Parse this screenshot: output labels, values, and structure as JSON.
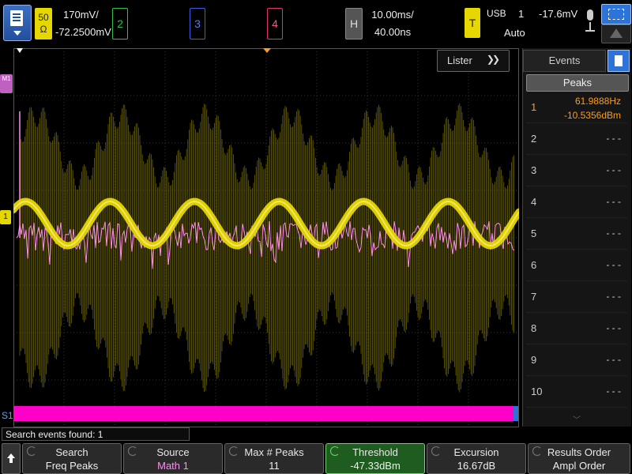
{
  "top_bar": {
    "ch1": {
      "coupling_label": "50",
      "ohm_label": "Ω",
      "scale": "170mV/",
      "offset": "-72.2500mV",
      "color": "#e6d700"
    },
    "ch2": {
      "label": "2",
      "color": "#2fbf4a"
    },
    "ch3": {
      "label": "3",
      "color": "#3a5fe0"
    },
    "ch4": {
      "label": "4",
      "color": "#e0336c"
    },
    "horizontal": {
      "label": "H",
      "time_per_div": "10.00ms/",
      "delay": "40.00ns"
    },
    "trigger": {
      "label": "T",
      "source": "USB",
      "channel": "1",
      "level": "-17.6mV",
      "mode": "Auto"
    }
  },
  "waveform": {
    "m1_marker": "M1",
    "ch1_marker": "1",
    "s1_label": "S1",
    "lister_label": "Lister",
    "chevron": "❯❯",
    "ch1_color": "#e6d700",
    "math_color": "#ff8cf0",
    "search_bar_color": "#ff00c8"
  },
  "events": {
    "tab_label": "Events",
    "peaks_label": "Peaks",
    "rows": [
      {
        "index": "1",
        "freq": "61.9888Hz",
        "ampl": "-10.5356dBm"
      },
      {
        "index": "2",
        "value": "- - -"
      },
      {
        "index": "3",
        "value": "- - -"
      },
      {
        "index": "4",
        "value": "- - -"
      },
      {
        "index": "5",
        "value": "- - -"
      },
      {
        "index": "6",
        "value": "- - -"
      },
      {
        "index": "7",
        "value": "- - -"
      },
      {
        "index": "8",
        "value": "- - -"
      },
      {
        "index": "9",
        "value": "- - -"
      },
      {
        "index": "10",
        "value": "- - -"
      }
    ]
  },
  "status_text": "Search events found: 1",
  "softkeys": [
    {
      "title": "Search",
      "value": "Freq Peaks",
      "value_color": "#eeeeee"
    },
    {
      "title": "Source",
      "value": "Math 1",
      "value_color": "#ff8cf0"
    },
    {
      "title": "Max # Peaks",
      "value": "11",
      "value_color": "#eeeeee"
    },
    {
      "title": "Threshold",
      "value": "-47.33dBm",
      "value_color": "#eeeeee"
    },
    {
      "title": "Excursion",
      "value": "16.67dB",
      "value_color": "#eeeeee"
    },
    {
      "title": "Results Order",
      "value": "Ampl Order",
      "value_color": "#eeeeee"
    }
  ]
}
